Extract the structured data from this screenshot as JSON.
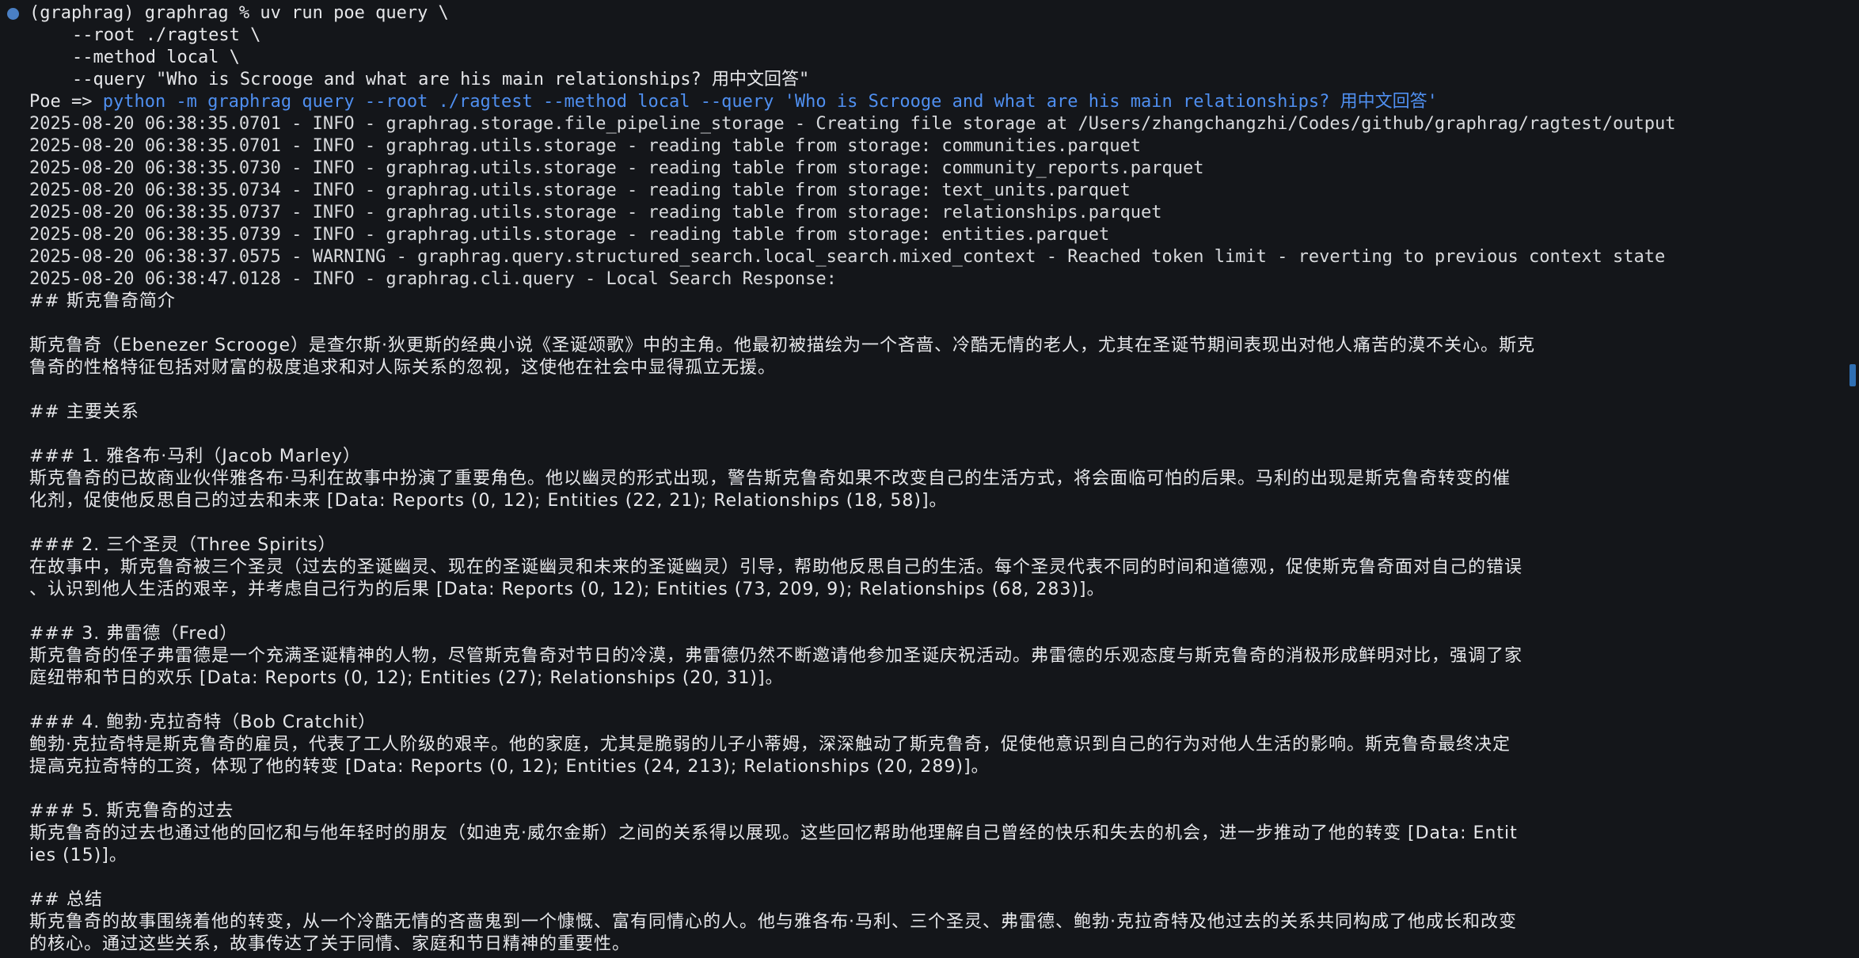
{
  "terminal": {
    "prompt_line": "(graphrag) graphrag % uv run poe query \\",
    "cmd_lines": [
      "--root ./ragtest \\",
      "--method local \\",
      "--query \"Who is Scrooge and what are his main relationships? 用中文回答\""
    ],
    "poe_prefix": "Poe => ",
    "poe_command": "python -m graphrag query --root ./ragtest --method local --query 'Who is Scrooge and what are his main relationships? 用中文回答'",
    "log_lines": [
      "2025-08-20 06:38:35.0701 - INFO - graphrag.storage.file_pipeline_storage - Creating file storage at /Users/zhangchangzhi/Codes/github/graphrag/ragtest/output",
      "2025-08-20 06:38:35.0701 - INFO - graphrag.utils.storage - reading table from storage: communities.parquet",
      "2025-08-20 06:38:35.0730 - INFO - graphrag.utils.storage - reading table from storage: community_reports.parquet",
      "2025-08-20 06:38:35.0734 - INFO - graphrag.utils.storage - reading table from storage: text_units.parquet",
      "2025-08-20 06:38:35.0737 - INFO - graphrag.utils.storage - reading table from storage: relationships.parquet",
      "2025-08-20 06:38:35.0739 - INFO - graphrag.utils.storage - reading table from storage: entities.parquet",
      "2025-08-20 06:38:37.0575 - WARNING - graphrag.query.structured_search.local_search.mixed_context - Reached token limit - reverting to previous context state",
      "2025-08-20 06:38:47.0128 - INFO - graphrag.cli.query - Local Search Response:"
    ],
    "response": {
      "h_intro": "## 斯克鲁奇简介",
      "intro_lines": [
        "斯克鲁奇（Ebenezer Scrooge）是查尔斯·狄更斯的经典小说《圣诞颂歌》中的主角。他最初被描绘为一个吝啬、冷酷无情的老人，尤其在圣诞节期间表现出对他人痛苦的漠不关心。斯克",
        "鲁奇的性格特征包括对财富的极度追求和对人际关系的忽视，这使他在社会中显得孤立无援。"
      ],
      "h_relations": "## 主要关系",
      "sections": [
        {
          "heading": "### 1. 雅各布·马利（Jacob Marley）",
          "lines": [
            "斯克鲁奇的已故商业伙伴雅各布·马利在故事中扮演了重要角色。他以幽灵的形式出现，警告斯克鲁奇如果不改变自己的生活方式，将会面临可怕的后果。马利的出现是斯克鲁奇转变的催",
            "化剂，促使他反思自己的过去和未来 [Data: Reports (0, 12); Entities (22, 21); Relationships (18, 58)]。"
          ]
        },
        {
          "heading": "### 2. 三个圣灵（Three Spirits）",
          "lines": [
            "在故事中，斯克鲁奇被三个圣灵（过去的圣诞幽灵、现在的圣诞幽灵和未来的圣诞幽灵）引导，帮助他反思自己的生活。每个圣灵代表不同的时间和道德观，促使斯克鲁奇面对自己的错误",
            "、认识到他人生活的艰辛，并考虑自己行为的后果 [Data: Reports (0, 12); Entities (73, 209, 9); Relationships (68, 283)]。"
          ]
        },
        {
          "heading": "### 3. 弗雷德（Fred）",
          "lines": [
            "斯克鲁奇的侄子弗雷德是一个充满圣诞精神的人物，尽管斯克鲁奇对节日的冷漠，弗雷德仍然不断邀请他参加圣诞庆祝活动。弗雷德的乐观态度与斯克鲁奇的消极形成鲜明对比，强调了家",
            "庭纽带和节日的欢乐 [Data: Reports (0, 12); Entities (27); Relationships (20, 31)]。"
          ]
        },
        {
          "heading": "### 4. 鲍勃·克拉奇特（Bob Cratchit）",
          "lines": [
            "鲍勃·克拉奇特是斯克鲁奇的雇员，代表了工人阶级的艰辛。他的家庭，尤其是脆弱的儿子小蒂姆，深深触动了斯克鲁奇，促使他意识到自己的行为对他人生活的影响。斯克鲁奇最终决定",
            "提高克拉奇特的工资，体现了他的转变 [Data: Reports (0, 12); Entities (24, 213); Relationships (20, 289)]。"
          ]
        },
        {
          "heading": "### 5. 斯克鲁奇的过去",
          "lines": [
            "斯克鲁奇的过去也通过他的回忆和与他年轻时的朋友（如迪克·威尔金斯）之间的关系得以展现。这些回忆帮助他理解自己曾经的快乐和失去的机会，进一步推动了他的转变 [Data: Entit",
            "ies (15)]。"
          ]
        }
      ],
      "h_summary": "## 总结",
      "summary_lines": [
        "斯克鲁奇的故事围绕着他的转变，从一个冷酷无情的吝啬鬼到一个慷慨、富有同情心的人。他与雅各布·马利、三个圣灵、弗雷德、鲍勃·克拉奇特及他过去的关系共同构成了他成长和改变",
        "的核心。通过这些关系，故事传达了关于同情、家庭和节日精神的重要性。"
      ]
    }
  },
  "colors": {
    "background": "#14161a",
    "text": "#e6e7ea",
    "accent_blue": "#4f8ff0",
    "prompt_dot": "#4a7fc4"
  }
}
